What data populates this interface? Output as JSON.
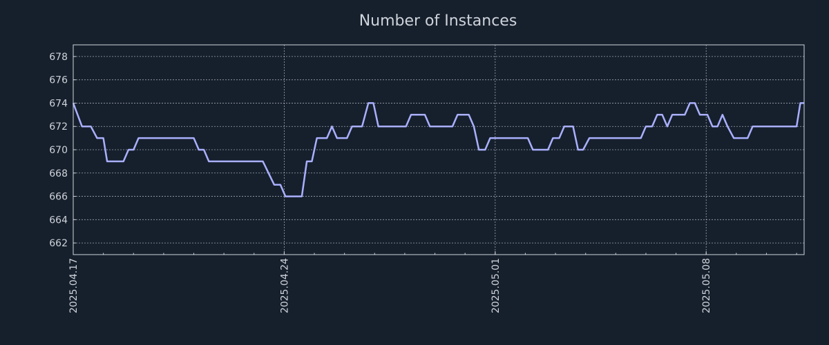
{
  "chart_data": {
    "type": "line",
    "title": "Number of Instances",
    "xlabel": "",
    "ylabel": "",
    "grid": true,
    "x_tick_labels": [
      "2025.04.17",
      "2025.04.24",
      "2025.05.01",
      "2025.05.08"
    ],
    "y_ticks": [
      662,
      664,
      666,
      668,
      670,
      672,
      674,
      676,
      678
    ],
    "x_range": [
      "2025-04-17T00:00",
      "2025-05-11T06:00"
    ],
    "ylim": [
      661,
      679
    ],
    "colors": {
      "background": "#16202d",
      "line": "#aab0ff",
      "text": "#cfd3da"
    },
    "series": [
      {
        "values": [
          [
            "2025-04-17T00:00",
            674
          ],
          [
            "2025-04-17T07:00",
            672
          ],
          [
            "2025-04-17T14:00",
            672
          ],
          [
            "2025-04-17T19:00",
            671
          ],
          [
            "2025-04-18T00:00",
            671
          ],
          [
            "2025-04-18T03:00",
            669
          ],
          [
            "2025-04-18T16:00",
            669
          ],
          [
            "2025-04-18T20:00",
            670
          ],
          [
            "2025-04-19T00:00",
            670
          ],
          [
            "2025-04-19T04:00",
            671
          ],
          [
            "2025-04-21T00:00",
            671
          ],
          [
            "2025-04-21T04:00",
            670
          ],
          [
            "2025-04-21T08:00",
            670
          ],
          [
            "2025-04-21T12:00",
            669
          ],
          [
            "2025-04-23T07:00",
            669
          ],
          [
            "2025-04-23T16:00",
            667
          ],
          [
            "2025-04-23T21:00",
            667
          ],
          [
            "2025-04-24T01:00",
            666
          ],
          [
            "2025-04-24T14:00",
            666
          ],
          [
            "2025-04-24T18:00",
            669
          ],
          [
            "2025-04-24T22:00",
            669
          ],
          [
            "2025-04-25T02:00",
            671
          ],
          [
            "2025-04-25T10:00",
            671
          ],
          [
            "2025-04-25T14:00",
            672
          ],
          [
            "2025-04-25T18:00",
            671
          ],
          [
            "2025-04-26T02:00",
            671
          ],
          [
            "2025-04-26T06:00",
            672
          ],
          [
            "2025-04-26T14:00",
            672
          ],
          [
            "2025-04-26T19:00",
            674
          ],
          [
            "2025-04-26T23:00",
            674
          ],
          [
            "2025-04-27T03:00",
            672
          ],
          [
            "2025-04-28T01:00",
            672
          ],
          [
            "2025-04-28T05:00",
            673
          ],
          [
            "2025-04-28T16:00",
            673
          ],
          [
            "2025-04-28T20:00",
            672
          ],
          [
            "2025-04-29T14:00",
            672
          ],
          [
            "2025-04-29T18:00",
            673
          ],
          [
            "2025-04-30T03:00",
            673
          ],
          [
            "2025-04-30T07:00",
            672
          ],
          [
            "2025-04-30T11:00",
            670
          ],
          [
            "2025-04-30T16:00",
            670
          ],
          [
            "2025-04-30T20:00",
            671
          ],
          [
            "2025-05-02T02:00",
            671
          ],
          [
            "2025-05-02T06:00",
            670
          ],
          [
            "2025-05-02T18:00",
            670
          ],
          [
            "2025-05-02T22:00",
            671
          ],
          [
            "2025-05-03T03:00",
            671
          ],
          [
            "2025-05-03T07:00",
            672
          ],
          [
            "2025-05-03T14:00",
            672
          ],
          [
            "2025-05-03T18:00",
            670
          ],
          [
            "2025-05-03T22:00",
            670
          ],
          [
            "2025-05-04T03:00",
            671
          ],
          [
            "2025-05-05T20:00",
            671
          ],
          [
            "2025-05-06T00:00",
            672
          ],
          [
            "2025-05-06T05:00",
            672
          ],
          [
            "2025-05-06T09:00",
            673
          ],
          [
            "2025-05-06T13:00",
            673
          ],
          [
            "2025-05-06T17:00",
            672
          ],
          [
            "2025-05-06T21:00",
            673
          ],
          [
            "2025-05-07T07:00",
            673
          ],
          [
            "2025-05-07T11:00",
            674
          ],
          [
            "2025-05-07T15:00",
            674
          ],
          [
            "2025-05-07T19:00",
            673
          ],
          [
            "2025-05-08T01:00",
            673
          ],
          [
            "2025-05-08T05:00",
            672
          ],
          [
            "2025-05-08T09:00",
            672
          ],
          [
            "2025-05-08T13:00",
            673
          ],
          [
            "2025-05-08T17:00",
            672
          ],
          [
            "2025-05-08T22:00",
            671
          ],
          [
            "2025-05-09T09:00",
            671
          ],
          [
            "2025-05-09T13:00",
            672
          ],
          [
            "2025-05-11T00:00",
            672
          ],
          [
            "2025-05-11T03:00",
            674
          ],
          [
            "2025-05-11T06:00",
            674
          ]
        ]
      }
    ]
  }
}
